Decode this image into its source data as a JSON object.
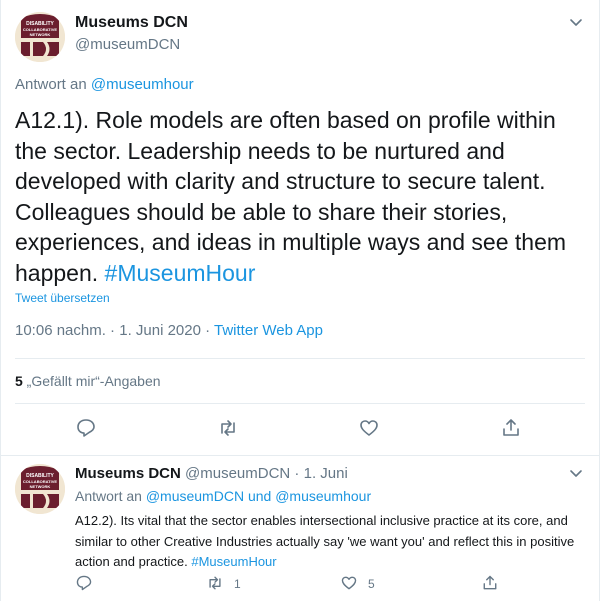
{
  "main_tweet": {
    "avatar_label": "DISABILITY COLLABORATIVE NETWORK",
    "display_name": "Museums DCN",
    "handle": "@museumDCN",
    "reply_prefix": "Antwort an ",
    "reply_target": "@museumhour",
    "text_body": "A12.1). Role models are often based on profile within the sector. Leadership needs to be nurtured and developed with clarity and structure to secure talent. Colleagues should be able to share their stories, experiences, and ideas in multiple ways and see them happen. ",
    "hashtag": "#MuseumHour",
    "translate_label": "Tweet übersetzen",
    "time": "10:06 nachm. · 1. Juni 2020 · ",
    "source": "Twitter Web App",
    "likes_count": "5",
    "likes_label": " „Gefällt mir“-Angaben"
  },
  "second_tweet": {
    "avatar_label": "DISABILITY COLLABORATIVE NETWORK",
    "display_name": "Museums DCN",
    "meta": " @museumDCN · 1. Juni",
    "reply_prefix": "Antwort an ",
    "reply_target": "@museumDCN und @museumhour",
    "text_body": "A12.2). Its vital that the sector enables intersectional inclusive practice at its core, and similar to other Creative Industries actually say 'we want you' and reflect this in positive action and practice. ",
    "hashtag": "#MuseumHour",
    "retweet_count": "1",
    "like_count": "5"
  },
  "colors": {
    "accent": "#1b95e0",
    "text": "#14171a",
    "secondary": "#657786",
    "border": "#e6ecf0",
    "logo_maroon": "#6b1e2e"
  },
  "icons": [
    "chevron-down-icon",
    "reply-icon",
    "retweet-icon",
    "like-icon",
    "share-icon"
  ]
}
